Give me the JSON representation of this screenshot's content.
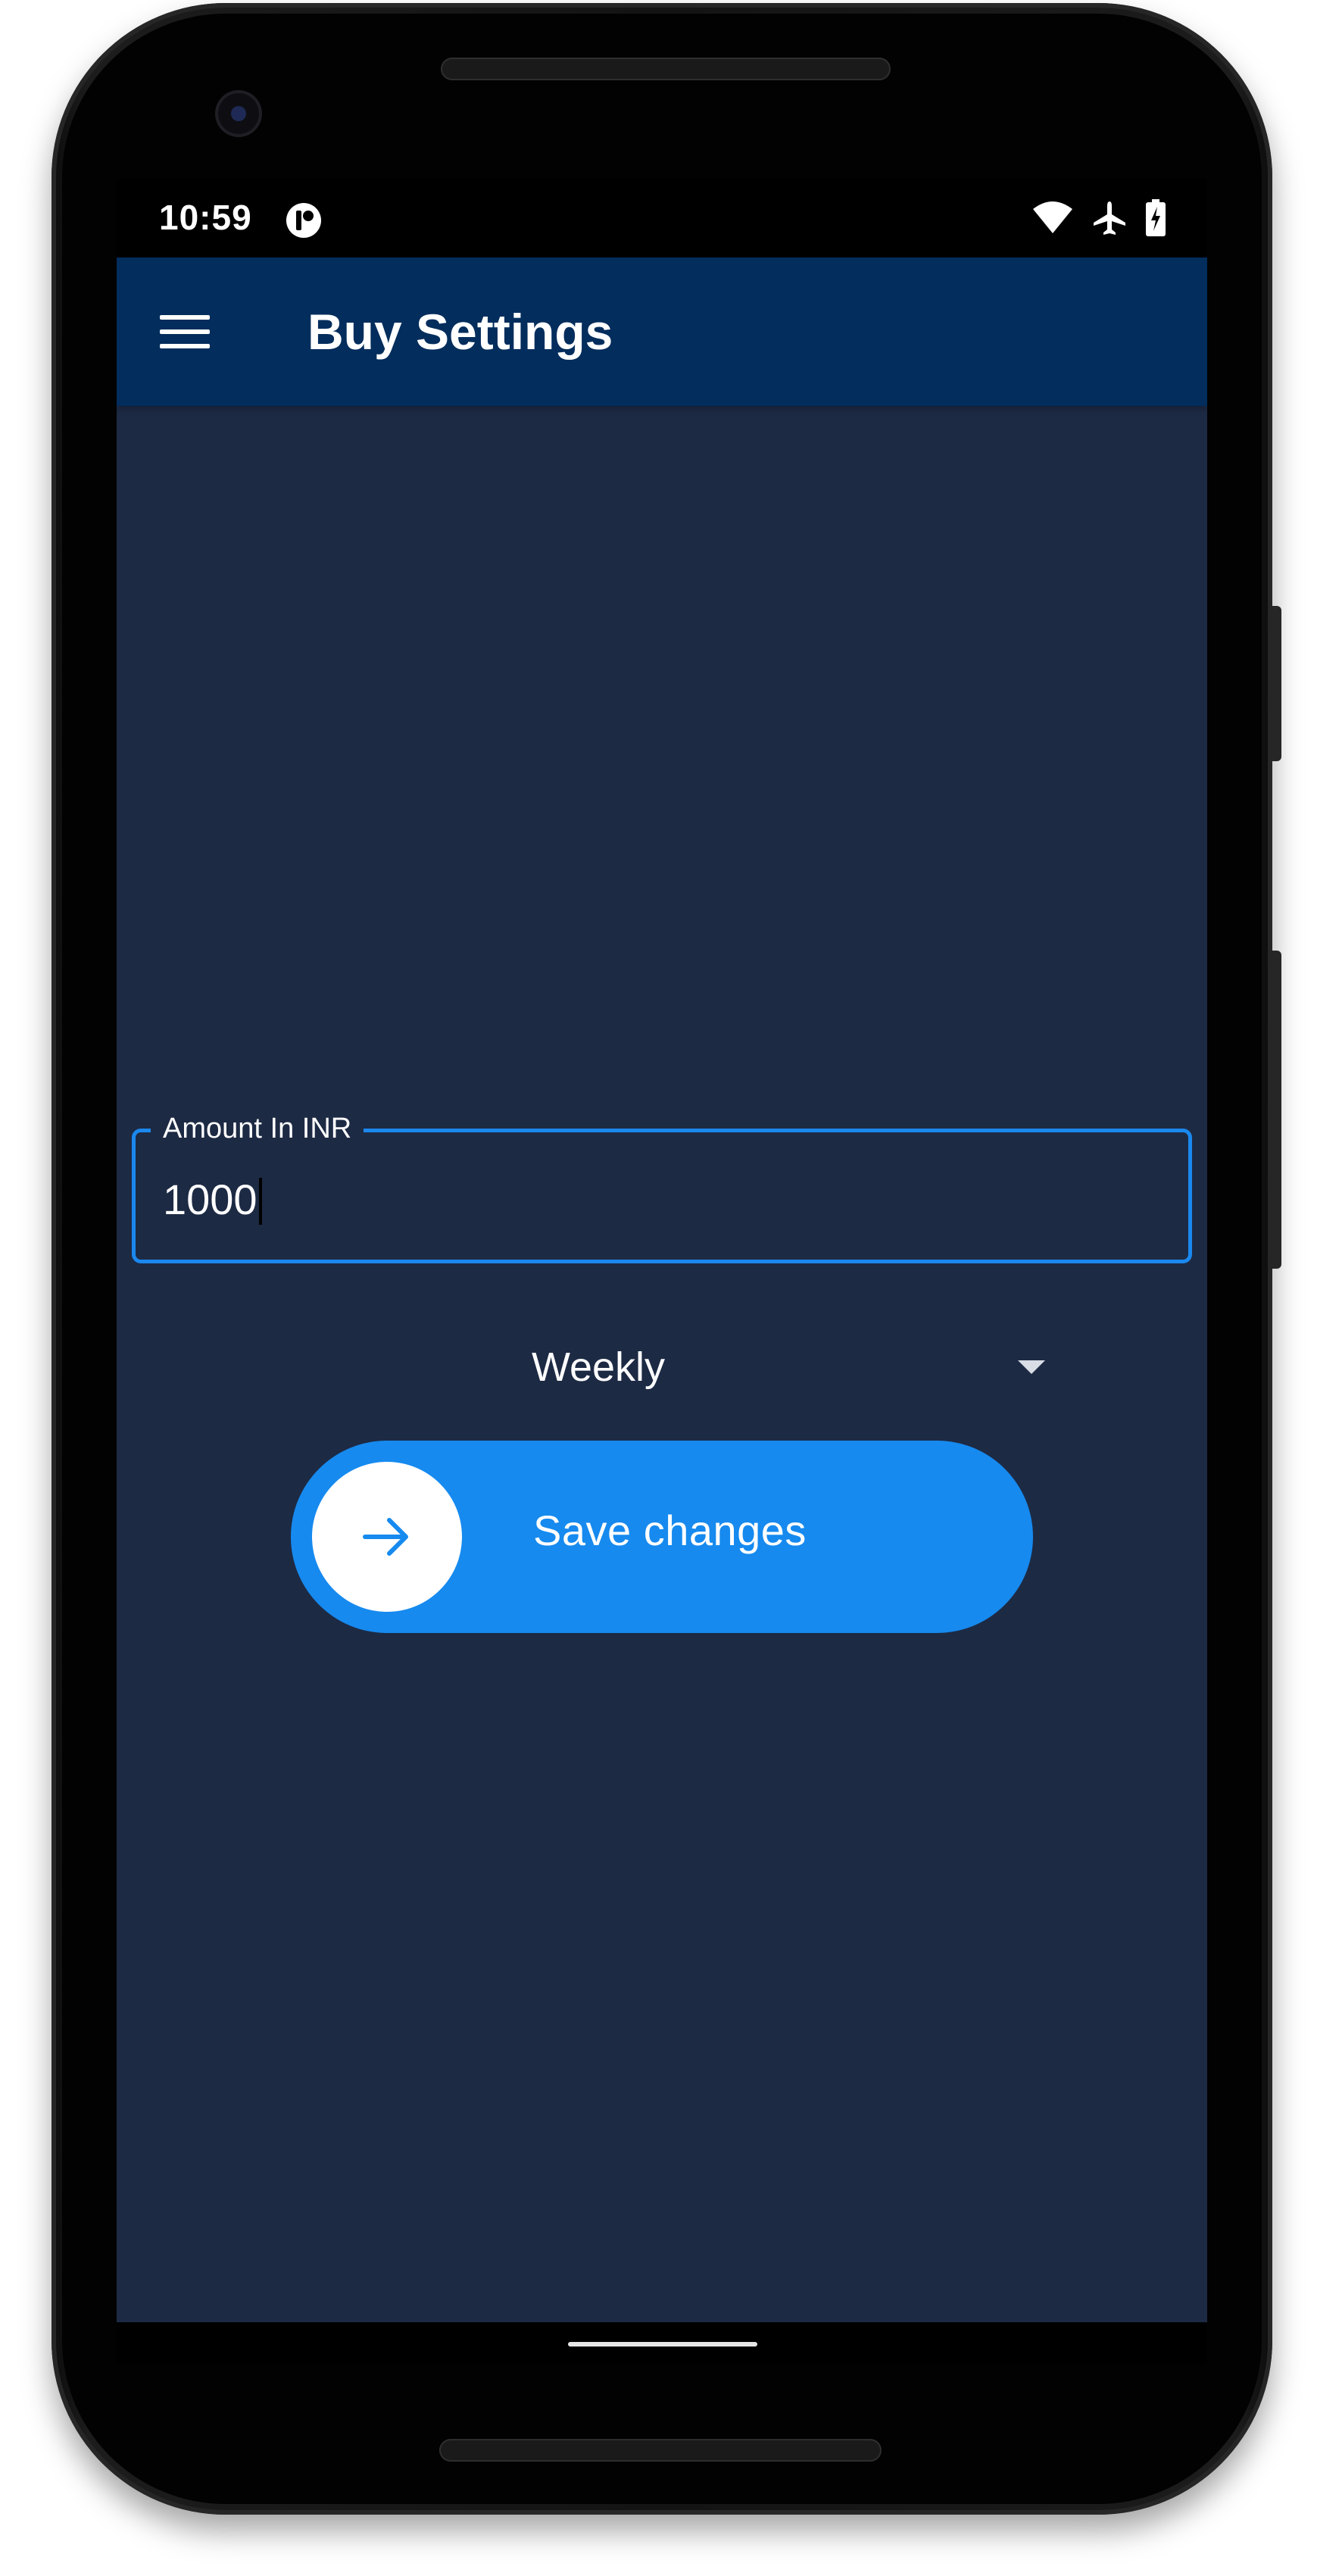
{
  "status_bar": {
    "time": "10:59",
    "app_icon": "app-notification-icon",
    "icons": [
      "wifi-icon",
      "airplane-mode-icon",
      "battery-charging-icon"
    ]
  },
  "app_bar": {
    "menu_icon": "hamburger-menu-icon",
    "title": "Buy Settings",
    "background_color": "#022d5c"
  },
  "form": {
    "amount": {
      "label": "Amount In INR",
      "value": "1000"
    },
    "frequency": {
      "selected": "Weekly"
    },
    "save_button": {
      "label": "Save changes",
      "icon": "arrow-right-icon",
      "color": "#168aef"
    }
  },
  "theme": {
    "screen_background": "#1d2a44",
    "accent": "#1a88ee"
  }
}
